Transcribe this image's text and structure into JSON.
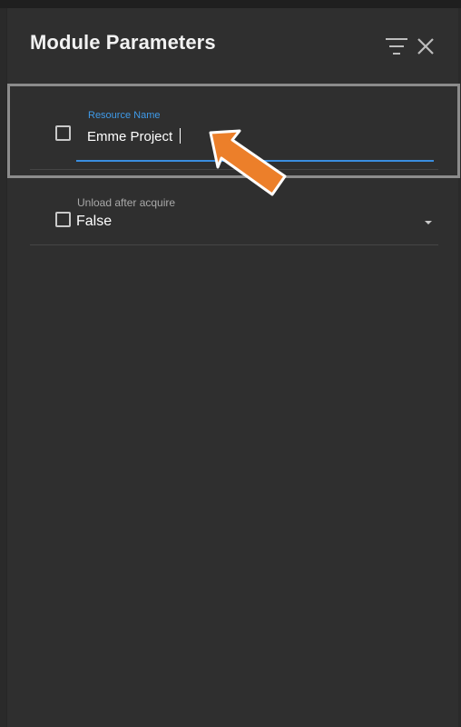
{
  "panel": {
    "title": "Module Parameters"
  },
  "parameters": [
    {
      "label": "Resource Name",
      "value": "Emme Project",
      "checked": false
    },
    {
      "label": "Unload after acquire",
      "value": "False",
      "checked": false
    }
  ],
  "icons": {
    "filter": "filter-icon",
    "close": "close-icon",
    "dropdown": "caret-down-icon",
    "annotation": "arrow-annotation"
  },
  "colors": {
    "background": "#2f2f2f",
    "accent": "#3a8ee0",
    "label_active": "#3f9ae8",
    "annotation_arrow": "#ec7f2a",
    "focus_outline": "#8c8c8c"
  }
}
